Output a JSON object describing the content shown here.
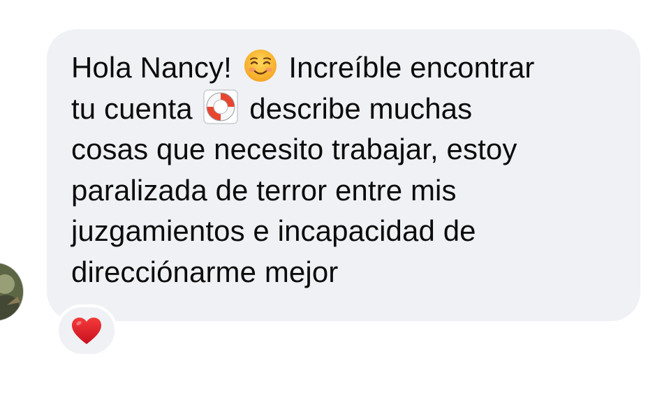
{
  "message": {
    "lines": [
      {
        "before": "Hola Nancy! ",
        "emoji": "smiling-face-emoji",
        "after": " Increíble encontrar"
      },
      {
        "before": "tu cuenta ",
        "emoji": "life-ring-emoji",
        "after": " describe muchas"
      },
      {
        "text": "cosas que necesito trabajar, estoy"
      },
      {
        "text": "paralizada de terror entre mis"
      },
      {
        "text": "juzgamientos e incapacidad de"
      },
      {
        "text": "direcciónarme mejor"
      }
    ]
  },
  "reaction": {
    "icon": "red-heart-icon",
    "color": "#e0202f"
  },
  "colors": {
    "bubble": "#f0f1f4",
    "text": "#0c0c0d",
    "background": "#ffffff"
  }
}
